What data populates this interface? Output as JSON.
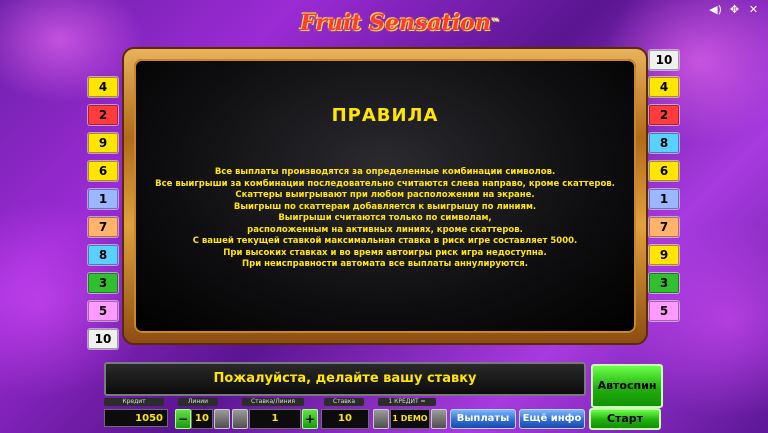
{
  "header": {
    "logo_text": "Fruit Sensation",
    "trademark": "™"
  },
  "top_icons": [
    "sound-icon",
    "move-icon",
    "close-icon"
  ],
  "left_badges": [
    {
      "label": "4",
      "color": "#ffe500"
    },
    {
      "label": "2",
      "color": "#ff3b3b"
    },
    {
      "label": "9",
      "color": "#ffe500"
    },
    {
      "label": "6",
      "color": "#ffe500"
    },
    {
      "label": "1",
      "color": "#9bb8ff"
    },
    {
      "label": "7",
      "color": "#ffb36b"
    },
    {
      "label": "8",
      "color": "#5ad0ff"
    },
    {
      "label": "3",
      "color": "#2fbf2f"
    },
    {
      "label": "5",
      "color": "#ff9bff"
    },
    {
      "label": "10",
      "color": "#f0f0f0"
    }
  ],
  "right_badges": [
    {
      "label": "10",
      "color": "#f0f0f0"
    },
    {
      "label": "4",
      "color": "#ffe500"
    },
    {
      "label": "2",
      "color": "#ff3b3b"
    },
    {
      "label": "8",
      "color": "#5ad0ff"
    },
    {
      "label": "6",
      "color": "#ffe500"
    },
    {
      "label": "1",
      "color": "#9bb8ff"
    },
    {
      "label": "7",
      "color": "#ffb36b"
    },
    {
      "label": "9",
      "color": "#ffe500"
    },
    {
      "label": "3",
      "color": "#2fbf2f"
    },
    {
      "label": "5",
      "color": "#ff9bff"
    }
  ],
  "rules": {
    "title": "ПРАВИЛА",
    "lines": [
      "Все выплаты производятся за определенные комбинации символов.",
      "Все выигрыши за комбинации последовательно считаются слева направо, кроме скаттеров.",
      "Скаттеры выигрывают при любом расположении на экране.",
      "Выигрыш по скаттерам добавляется к выигрышу по линиям.",
      "Выигрыши считаются только по символам,",
      "расположенным на активных линиях, кроме скаттеров.",
      "С вашей текущей ставкой максимальная ставка в риск игре составляет 5000.",
      "При высоких ставках и во время автоигры риск игра недоступна.",
      "При неисправности автомата все выплаты аннулируются."
    ]
  },
  "message": "Пожалуйста, делайте вашу ставку",
  "autospin_label": "Автоспин",
  "controls": {
    "credit_label": "Кредит",
    "credit_value": "1050",
    "lines_label": "Линии",
    "lines_value": "10",
    "bet_per_line_label": "Ставка/Линия",
    "bet_per_line_value": "1",
    "total_bet_label": "Ставка",
    "total_bet_value": "10",
    "credit_denom_label": "1 КРЕДИТ =",
    "denom_value": "1 DEMO",
    "minus": "−",
    "plus": "+",
    "payouts_label": "Выплаты",
    "more_info_label": "Ещё инфо",
    "start_label": "Старт"
  }
}
